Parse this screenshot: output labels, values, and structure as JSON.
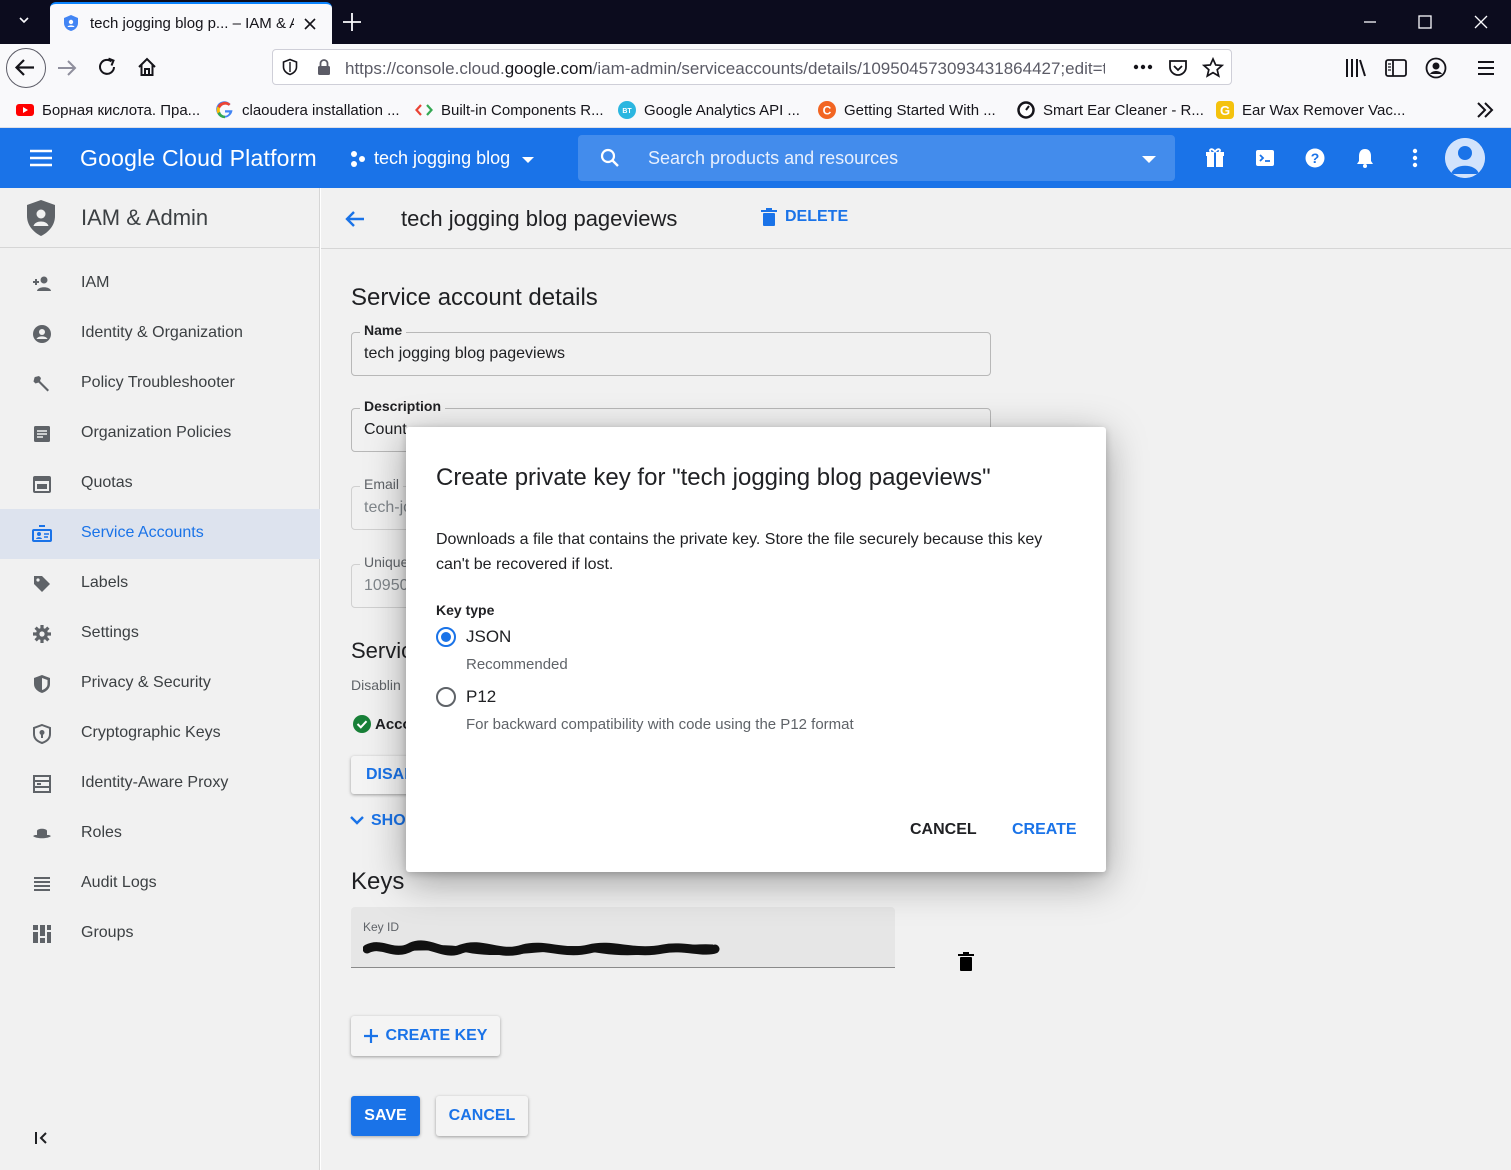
{
  "browser": {
    "tab_title": "tech jogging blog p... – IAM & Admin",
    "url_prefix": "https://console.cloud.",
    "url_domain": "google.com",
    "url_path": "/iam-admin/serviceaccounts/details/109504573093431864427;edit=t",
    "bookmarks": [
      {
        "label": "Борная кислота. Пра...",
        "icon": "youtube-icon",
        "color": "#ff0000"
      },
      {
        "label": "claoudera installation ...",
        "icon": "google-icon",
        "color": "#4285f4"
      },
      {
        "label": "Built-in Components R...",
        "icon": "code-icon",
        "color": "#34a853"
      },
      {
        "label": "Google Analytics API ...",
        "icon": "bt-icon",
        "color": "#2bb6e0"
      },
      {
        "label": "Getting Started With ...",
        "icon": "c-icon",
        "color": "#f26522"
      },
      {
        "label": "Smart Ear Cleaner - R...",
        "icon": "clock-icon",
        "color": "#15141a"
      },
      {
        "label": "Ear Wax Remover Vac...",
        "icon": "g-icon",
        "color": "#f4c20d"
      }
    ]
  },
  "gcp": {
    "title": "Google Cloud Platform",
    "project": "tech jogging blog",
    "search_placeholder": "Search products and resources",
    "accent": "#1a73e8"
  },
  "sidebar": {
    "title": "IAM & Admin",
    "items": [
      {
        "label": "IAM",
        "icon": "person-add-icon"
      },
      {
        "label": "Identity & Organization",
        "icon": "account-circle-icon"
      },
      {
        "label": "Policy Troubleshooter",
        "icon": "wrench-icon"
      },
      {
        "label": "Organization Policies",
        "icon": "article-icon"
      },
      {
        "label": "Quotas",
        "icon": "calendar-icon"
      },
      {
        "label": "Service Accounts",
        "icon": "service-account-icon",
        "active": true
      },
      {
        "label": "Labels",
        "icon": "tag-icon"
      },
      {
        "label": "Settings",
        "icon": "gear-icon"
      },
      {
        "label": "Privacy & Security",
        "icon": "shield-icon"
      },
      {
        "label": "Cryptographic Keys",
        "icon": "key-shield-icon"
      },
      {
        "label": "Identity-Aware Proxy",
        "icon": "proxy-icon"
      },
      {
        "label": "Roles",
        "icon": "hat-icon"
      },
      {
        "label": "Audit Logs",
        "icon": "list-icon"
      },
      {
        "label": "Groups",
        "icon": "grid-icon"
      }
    ]
  },
  "main": {
    "page_title": "tech jogging blog pageviews",
    "delete_label": "DELETE",
    "section_title": "Service account details",
    "name_label": "Name",
    "name_value": "tech jogging blog pageviews",
    "description_label": "Description",
    "description_value": "Count",
    "email_label": "Email",
    "email_value": "tech-jo",
    "unique_label": "Unique",
    "unique_value": "10950",
    "status_section_partial": "Servic",
    "status_desc_partial": "Disablin",
    "status_partial": "Acco",
    "disable_partial": "DISAB",
    "show_partial": "SHO",
    "keys_title": "Keys",
    "key_id_label": "Key ID",
    "create_key_label": "CREATE KEY",
    "save_label": "SAVE",
    "cancel_label": "CANCEL"
  },
  "dialog": {
    "title": "Create private key for \"tech jogging blog pageviews\"",
    "description": "Downloads a file that contains the private key. Store the file securely because this key can't be recovered if lost.",
    "key_type_label": "Key type",
    "options": [
      {
        "label": "JSON",
        "sublabel": "Recommended",
        "selected": true
      },
      {
        "label": "P12",
        "sublabel": "For backward compatibility with code using the P12 format",
        "selected": false
      }
    ],
    "cancel_label": "CANCEL",
    "create_label": "CREATE"
  }
}
